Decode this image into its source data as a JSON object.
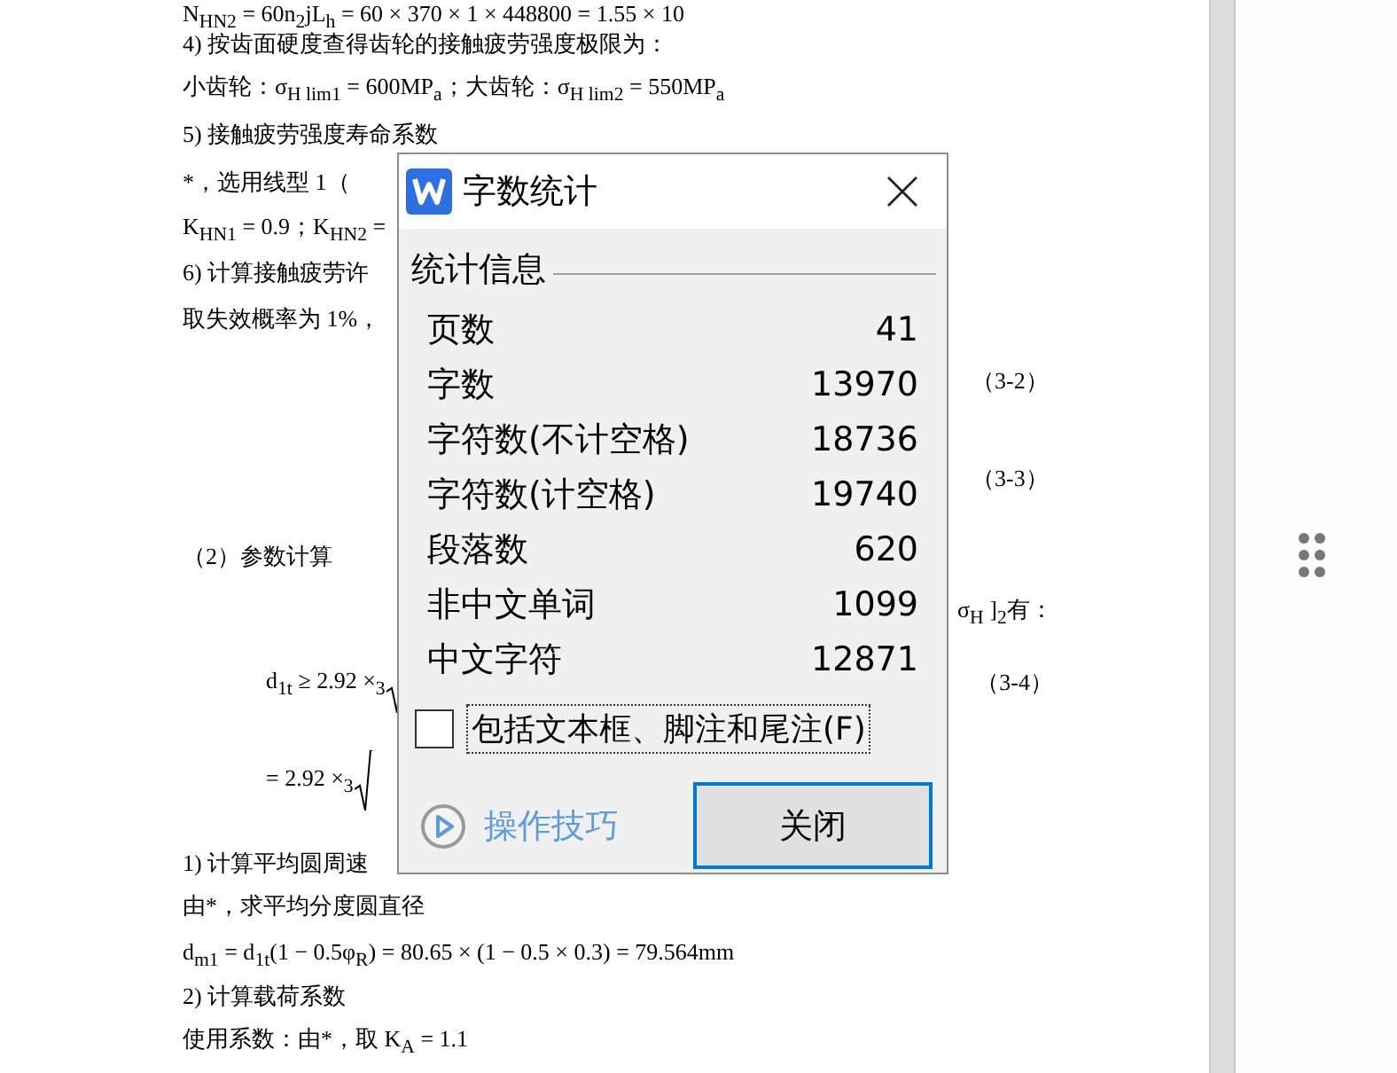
{
  "document": {
    "lines": [
      {
        "kind": "formula",
        "text": "N$_{HN2}$ = 60n$_{2}$jL$_{h}$ = 60 × 370 × 1 × 448800 = 1.55 × 10"
      },
      {
        "kind": "text",
        "text": "4)  按齿面硬度查得齿轮的接触疲劳强度极限为："
      },
      {
        "kind": "text",
        "text": "小齿轮：σ$_{H lim1}$ = 600MP$_{a}$；大齿轮：σ$_{H lim2}$ = 550MP$_{a}$"
      },
      {
        "kind": "text",
        "text": "5)  接触疲劳强度寿命系数"
      },
      {
        "kind": "text",
        "text": "*，选用线型 1（"
      },
      {
        "kind": "formula",
        "text": "K$_{HN1}$ = 0.9；K$_{HN2}$ ="
      },
      {
        "kind": "text",
        "text": "6)  计算接触疲劳许"
      },
      {
        "kind": "text",
        "text": "取失效概率为 1%，"
      },
      {
        "kind": "number",
        "text": "（3-2）"
      },
      {
        "kind": "number",
        "text": "（3-3）"
      },
      {
        "kind": "text",
        "text": "（2）参数计算"
      },
      {
        "kind": "right",
        "text": "σ$_{H}$ ]$_{2}$有："
      },
      {
        "kind": "root",
        "text": "d$_{1t}$ ≥ 2.92 ×$_{3}$",
        "number": "（3-4）"
      },
      {
        "kind": "root",
        "text": "= 2.92 ×$_{3}$"
      },
      {
        "kind": "text",
        "text": "1)  计算平均圆周速"
      },
      {
        "kind": "text",
        "text": "由*，求平均分度圆直径"
      },
      {
        "kind": "formula",
        "text": "d$_{m1}$ = d$_{1t}$(1 − 0.5φ$_{R}$) = 80.65 × (1 − 0.5 × 0.3) = 79.564mm"
      },
      {
        "kind": "text",
        "text": "2)  计算载荷系数"
      },
      {
        "kind": "text",
        "text": "使用系数：由*，取 K$_{A}$ = 1.1"
      }
    ]
  },
  "dialog": {
    "title": "字数统计",
    "group": "统计信息",
    "stats": [
      {
        "label": "页数",
        "value": "41"
      },
      {
        "label": "字数",
        "value": "13970"
      },
      {
        "label": "字符数(不计空格)",
        "value": "18736"
      },
      {
        "label": "字符数(计空格)",
        "value": "19740"
      },
      {
        "label": "段落数",
        "value": "620"
      },
      {
        "label": "非中文单词",
        "value": "1099"
      },
      {
        "label": "中文字符",
        "value": "12871"
      }
    ],
    "checkbox": {
      "label": "包括文本框、脚注和尾注(F)",
      "checked": false
    },
    "link": "操作技巧",
    "button": "关闭"
  }
}
